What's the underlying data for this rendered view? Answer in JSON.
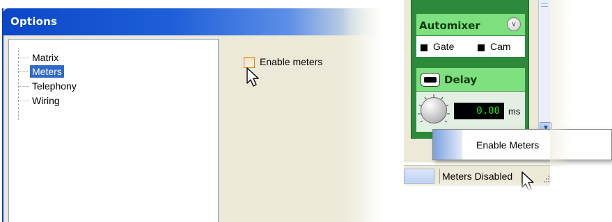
{
  "options_dialog": {
    "title": "Options",
    "tree_items": [
      {
        "label": "Matrix",
        "selected": false
      },
      {
        "label": "Meters",
        "selected": true
      },
      {
        "label": "Telephony",
        "selected": false
      },
      {
        "label": "Wiring",
        "selected": false
      }
    ],
    "enable_meters_checkbox": {
      "label": "Enable meters",
      "checked": false
    }
  },
  "mixer_panel": {
    "automixer": {
      "title": "Automixer",
      "options": [
        "Gate",
        "Cam"
      ]
    },
    "delay": {
      "title": "Delay",
      "value": "0.00",
      "unit": "ms"
    },
    "context_menu": {
      "items": [
        "Enable Meters"
      ]
    },
    "status_bar": {
      "meters_status": "Meters Disabled"
    }
  },
  "colors": {
    "title_bar": "#0a47c8",
    "selection": "#316ac5",
    "panel_green": "#2d8a3a",
    "header_green": "#7ee07e",
    "readout_text": "#28e028"
  },
  "icons": [
    "mouse-pointer-icon",
    "chevron-double-down-icon",
    "scroll-down-arrow-icon",
    "size-grip-icon"
  ]
}
